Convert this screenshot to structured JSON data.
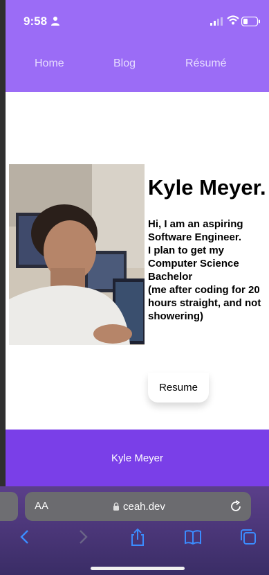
{
  "status_bar": {
    "time": "9:58"
  },
  "nav": {
    "items": [
      "Home",
      "Blog",
      "Résumé"
    ]
  },
  "profile": {
    "name": "Kyle Meyer.",
    "bio_lines": [
      "Hi, I am an aspiring",
      "Software Engineer.",
      "I plan to get my",
      "Computer Science",
      "Bachelor",
      "(me after coding for 20",
      "hours straight, and not",
      "showering)"
    ],
    "resume_button": "Resume"
  },
  "footer": {
    "text": "Kyle Meyer"
  },
  "browser": {
    "text_size_label": "AA",
    "url": "ceah.dev"
  },
  "colors": {
    "header": "#9b6cf6",
    "footer": "#7a3fe8",
    "nav_text": "#e6dcff"
  }
}
